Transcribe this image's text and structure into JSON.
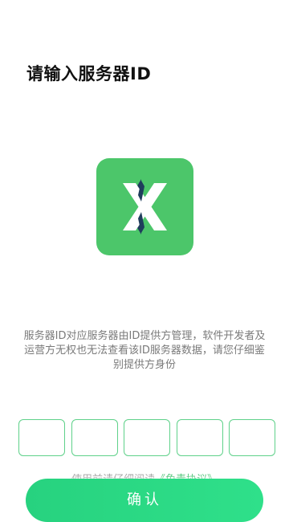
{
  "header": {
    "title": "请输入服务器ID"
  },
  "logo": {
    "icon": "x-logo-icon",
    "background_color": "#4cc66a"
  },
  "disclaimer": {
    "text": "服务器ID对应服务器由ID提供方管理，软件开发者及运营方无权也无法查看该ID服务器数据，请您仔细鉴别提供方身份"
  },
  "code_input": {
    "boxes": [
      "",
      "",
      "",
      "",
      ""
    ],
    "border_color": "#5fd18a"
  },
  "agreement": {
    "prefix": "使用前请仔细阅读",
    "link_label": "《免责协议》"
  },
  "actions": {
    "confirm_label": "确认",
    "confirm_color": "#2ad983"
  }
}
